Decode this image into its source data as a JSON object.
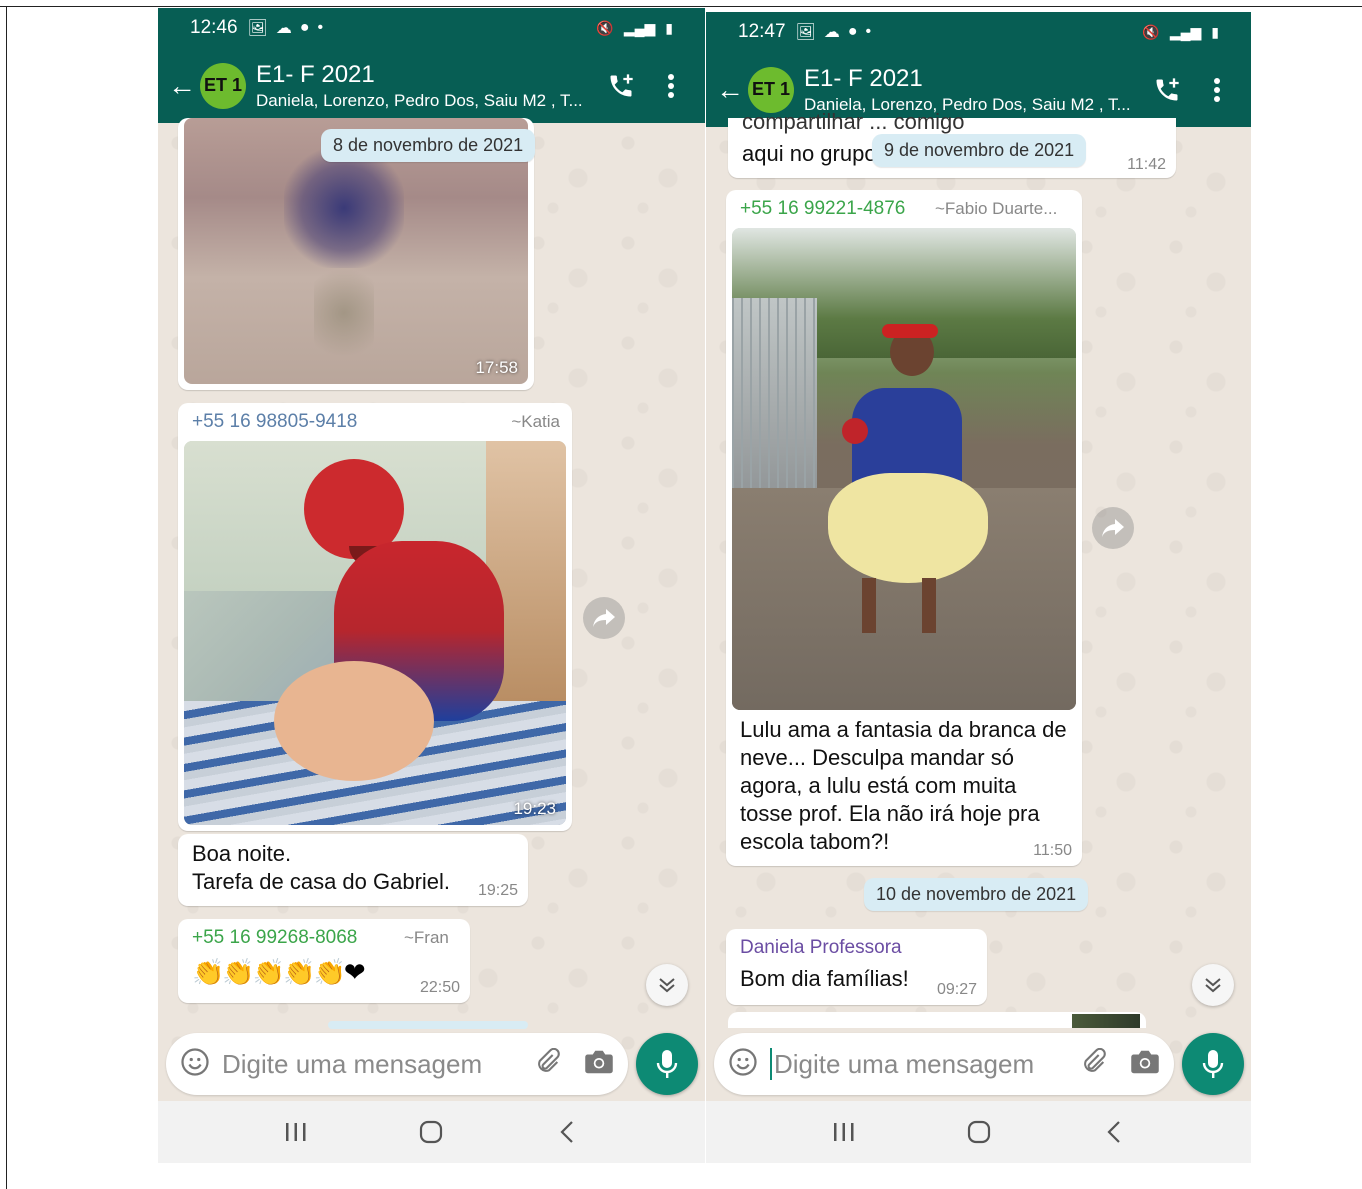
{
  "phones": [
    {
      "status": {
        "time": "12:46"
      },
      "header": {
        "avatar_text": "ET 1",
        "title": "E1- F 2021",
        "members": "Daniela, Lorenzo, Pedro Dos, Saiu M2 , T..."
      },
      "date_pill": "8 de novembro de 2021",
      "photo1_time": "17:58",
      "msg_katia": {
        "sender": "+55 16 98805-9418",
        "alias": "~Katia",
        "photo_time": "19:23",
        "text_line1": "Boa noite.",
        "text_line2": "Tarefa de casa do Gabriel.",
        "time": "19:25"
      },
      "msg_fran": {
        "sender": "+55 16 99268-8068",
        "alias": "~Fran",
        "emojis": "👏👏👏👏👏❤",
        "time": "22:50"
      },
      "input_placeholder": "Digite uma mensagem"
    },
    {
      "status": {
        "time": "12:47"
      },
      "header": {
        "avatar_text": "ET 1",
        "title": "E1- F 2021",
        "members": "Daniela, Lorenzo, Pedro Dos, Saiu M2 , T..."
      },
      "prev_msg": {
        "line1": "compartilhar ... comigo",
        "line2": "aqui no grupo",
        "time": "11:42"
      },
      "date_pill": "9 de novembro de 2021",
      "msg_fabio": {
        "sender": "+55 16 99221-4876",
        "alias": "~Fabio Duarte...",
        "text": "Lulu ama a fantasia da branca de neve... Desculpa mandar só agora, a lulu está com muita tosse prof. Ela não irá hoje pra escola tabom?!",
        "time": "11:50"
      },
      "date_pill2": "10 de novembro de 2021",
      "msg_daniela": {
        "sender": "Daniela Professora",
        "text": "Bom dia famílias!",
        "time": "09:27"
      },
      "input_placeholder": "Digite uma mensagem"
    }
  ],
  "colors": {
    "header": "#075e54",
    "mic": "#0d8a74",
    "chat_bg": "#ece5dd",
    "avatar": "#6dbb2e"
  },
  "icons": [
    "back-arrow-icon",
    "add-call-icon",
    "more-vert-icon",
    "emoji-icon",
    "attach-icon",
    "camera-icon",
    "mic-icon",
    "forward-icon",
    "scroll-down-icon",
    "recents-icon",
    "home-icon",
    "back-nav-icon"
  ]
}
